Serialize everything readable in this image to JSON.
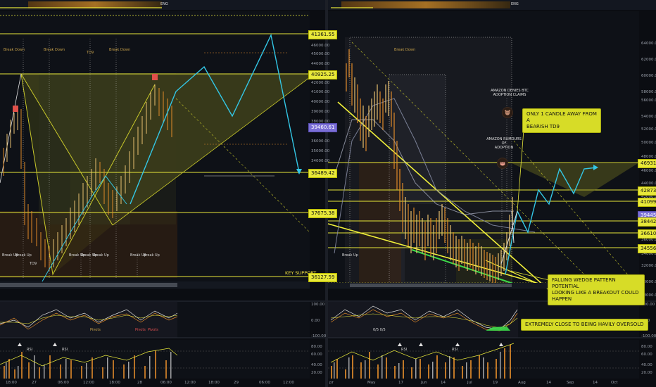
{
  "left_panel": {
    "price_axis": [
      "46000.00",
      "45000.00",
      "44000.00",
      "43000.00",
      "42000.00",
      "41000.00",
      "40000.00",
      "39000.00",
      "38000.00",
      "37000.00",
      "36000.00",
      "35000.00",
      "34000.00"
    ],
    "price_labels": [
      {
        "text": "41361.55",
        "style": "yellow"
      },
      {
        "text": "40925.25",
        "style": "yellow"
      },
      {
        "text": "39460.61",
        "style": "purple"
      },
      {
        "text": "36489.42",
        "style": "yellow"
      },
      {
        "text": "37675.38",
        "style": "yellow"
      },
      {
        "text": "36127.59",
        "style": "yellow"
      }
    ],
    "time_axis": [
      "18:00",
      "27",
      "06:00",
      "12:00",
      "18:00",
      "28",
      "06:00",
      "12:00",
      "18:00",
      "29",
      "06:00",
      "12:00"
    ],
    "annotations_top": [
      "Break Down",
      "Break Down",
      "TD9",
      "Break Down"
    ],
    "annotations_bottom": [
      "Break Up",
      "Break Up",
      "Break Up",
      "Break Up",
      "Break Up",
      "Break Up",
      "Break Up"
    ],
    "td9_label": "TD9",
    "key_support": "KEY SUPPORT",
    "osc_axis": [
      "100.00",
      "0.00",
      "-100.00"
    ],
    "rsi_axis": [
      "80.00",
      "60.00",
      "40.00",
      "20.00"
    ],
    "osc_labels": [
      "Pivots",
      "Pivots",
      "Pivots"
    ],
    "rsi_label": "RSI",
    "top_bar_text": "ENG"
  },
  "right_panel": {
    "price_axis": [
      "64000.00",
      "62000.00",
      "60000.00",
      "58000.00",
      "56000.00",
      "54000.00",
      "52000.00",
      "50000.00",
      "48000.00",
      "46000.00",
      "44000.00",
      "42000.00",
      "40000.00",
      "38000.00",
      "36000.00",
      "34000.00",
      "32000.00",
      "30000.00",
      "28000.00"
    ],
    "price_labels": [
      {
        "text": "46931.38",
        "style": "yellow"
      },
      {
        "text": "42873.18",
        "style": "yellow"
      },
      {
        "text": "41099.21",
        "style": "yellow"
      },
      {
        "text": "39445.83",
        "style": "purple"
      },
      {
        "text": "38442.23",
        "style": "yellow"
      },
      {
        "text": "36610.57",
        "style": "yellow"
      },
      {
        "text": "34556.58",
        "style": "yellow"
      }
    ],
    "time_axis": [
      "pr",
      "May",
      "17",
      "Jun",
      "14",
      "Jul",
      "19",
      "Aug",
      "14",
      "Sep",
      "14",
      "Oct"
    ],
    "callout_td9": "ONLY 1 CANDLE AWAY FROM A\nBEARISH TD9",
    "callout_wedge": "FALLING WEDGE PATTERN POTENTIAL\nLOOKING LIKE A BREAKOUT COULD HAPPEN",
    "callout_oversold": "EXTREMELY CLOSE TO BEING HAVILY OVERSOLD",
    "note_amazon_denies": "AMAZON DENIES BTC\nADOPTION CLAIMS",
    "note_amazon_rumours": "AMAZON RUMOURS OF\nADOPTION",
    "annotations": [
      "Break Up",
      "Break Down"
    ],
    "osc_axis": [
      "100.00",
      "0.00",
      "-100.00"
    ],
    "rsi_axis": [
      "80.00",
      "60.00",
      "40.00",
      "20.00"
    ],
    "rsi_label": "RSI",
    "osc_label": "0/5 0/5",
    "top_bar_text": "ENG",
    "bull_icon": "bull-icon",
    "bear_icon": "bear-icon"
  },
  "colors": {
    "background": "#0b0d12",
    "yellow": "#e8e83a",
    "cyan": "#33c7e6",
    "green": "#3ddc4a",
    "orange": "#e08a2a",
    "purple": "#7b6fd6"
  }
}
